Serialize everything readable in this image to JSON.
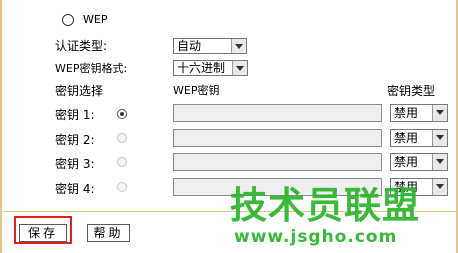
{
  "wep_option": {
    "label": "WEP",
    "selected": false
  },
  "auth_type": {
    "label": "认证类型:",
    "value": "自动"
  },
  "key_format": {
    "label": "WEP密钥格式:",
    "value": "十六进制"
  },
  "columns": {
    "select": "密钥选择",
    "key": "WEP密钥",
    "type": "密钥类型"
  },
  "keys": [
    {
      "label": "密钥 1:",
      "selected": true,
      "value": "",
      "type": "禁用"
    },
    {
      "label": "密钥 2:",
      "selected": false,
      "value": "",
      "type": "禁用"
    },
    {
      "label": "密钥 3:",
      "selected": false,
      "value": "",
      "type": "禁用"
    },
    {
      "label": "密钥 4:",
      "selected": false,
      "value": "",
      "type": "禁用"
    }
  ],
  "buttons": {
    "save": "保存",
    "help": "帮助"
  },
  "watermark": {
    "title": "技术员联盟",
    "url": "www.jsgho.com"
  },
  "colors": {
    "frame_border": "#e4c58a",
    "highlight": "#e02020",
    "watermark": "#2ab42a"
  }
}
